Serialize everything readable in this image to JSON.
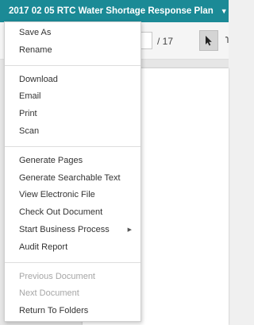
{
  "header": {
    "title": "2017 02 05 RTC Water Shortage Response Plan",
    "caret": "▼"
  },
  "toolbar": {
    "page_total": "/ 17"
  },
  "menu": {
    "groups": [
      [
        {
          "label": "Save As"
        },
        {
          "label": "Rename"
        }
      ],
      [
        {
          "label": "Download"
        },
        {
          "label": "Email"
        },
        {
          "label": "Print"
        },
        {
          "label": "Scan"
        }
      ],
      [
        {
          "label": "Generate Pages"
        },
        {
          "label": "Generate Searchable Text"
        },
        {
          "label": "View Electronic File"
        },
        {
          "label": "Check Out Document"
        },
        {
          "label": "Start Business Process",
          "submenu": true
        },
        {
          "label": "Audit Report"
        }
      ],
      [
        {
          "label": "Previous Document",
          "disabled": true
        },
        {
          "label": "Next Document",
          "disabled": true
        },
        {
          "label": "Return To Folders"
        }
      ]
    ],
    "submenu_arrow": "▶"
  },
  "colors": {
    "header_bg": "#1b8a96",
    "disabled_text": "#a6a6a6"
  }
}
